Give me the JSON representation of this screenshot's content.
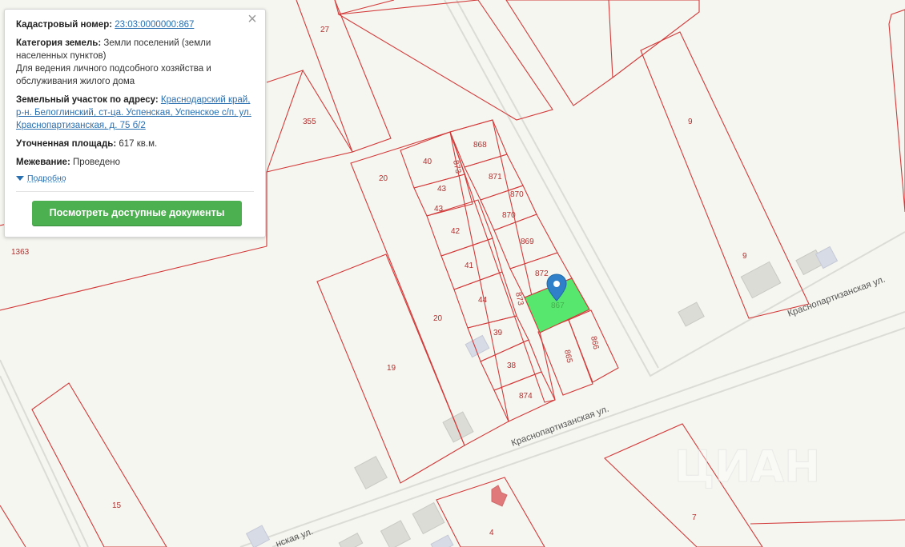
{
  "info_card": {
    "cadastral_label": "Кадастровый номер:",
    "cadastral_value": "23:03:0000000:867",
    "category_label": "Категория земель:",
    "category_value": "Земли поселений (земли населенных пунктов)",
    "usage": "Для ведения личного подсобного хозяйства и обслуживания жилого дома",
    "address_label": "Земельный участок по адресу:",
    "address_value": "Краснодарский край, р-н. Белоглинский, ст-ца. Успенская, Успенское с/п, ул. Краснопартизанская, д. 75 б/2",
    "area_label": "Уточненная площадь:",
    "area_value": "617 кв.м.",
    "survey_label": "Межевание:",
    "survey_value": "Проведено",
    "more_label": "Подробно",
    "docs_button": "Посмотреть доступные документы",
    "close_glyph": "×"
  },
  "map": {
    "street_labels": [
      "Краснопартизанская ул.",
      "Краснопартизанская ул.",
      "нская ул."
    ],
    "watermark": "ЦИАН",
    "plot_labels": [
      "27",
      "355",
      "9",
      "9",
      "1363",
      "868",
      "40",
      "873",
      "871",
      "20",
      "43",
      "870",
      "43",
      "870",
      "42",
      "869",
      "41",
      "872",
      "44",
      "873",
      "867",
      "20",
      "39",
      "866",
      "865",
      "38",
      "19",
      "874",
      "15",
      "7",
      "4"
    ],
    "colors": {
      "plot_border": "#d23a3a",
      "selected_plot": "#57e66e",
      "marker": "#2f7fc9",
      "button": "#4caf50"
    }
  }
}
